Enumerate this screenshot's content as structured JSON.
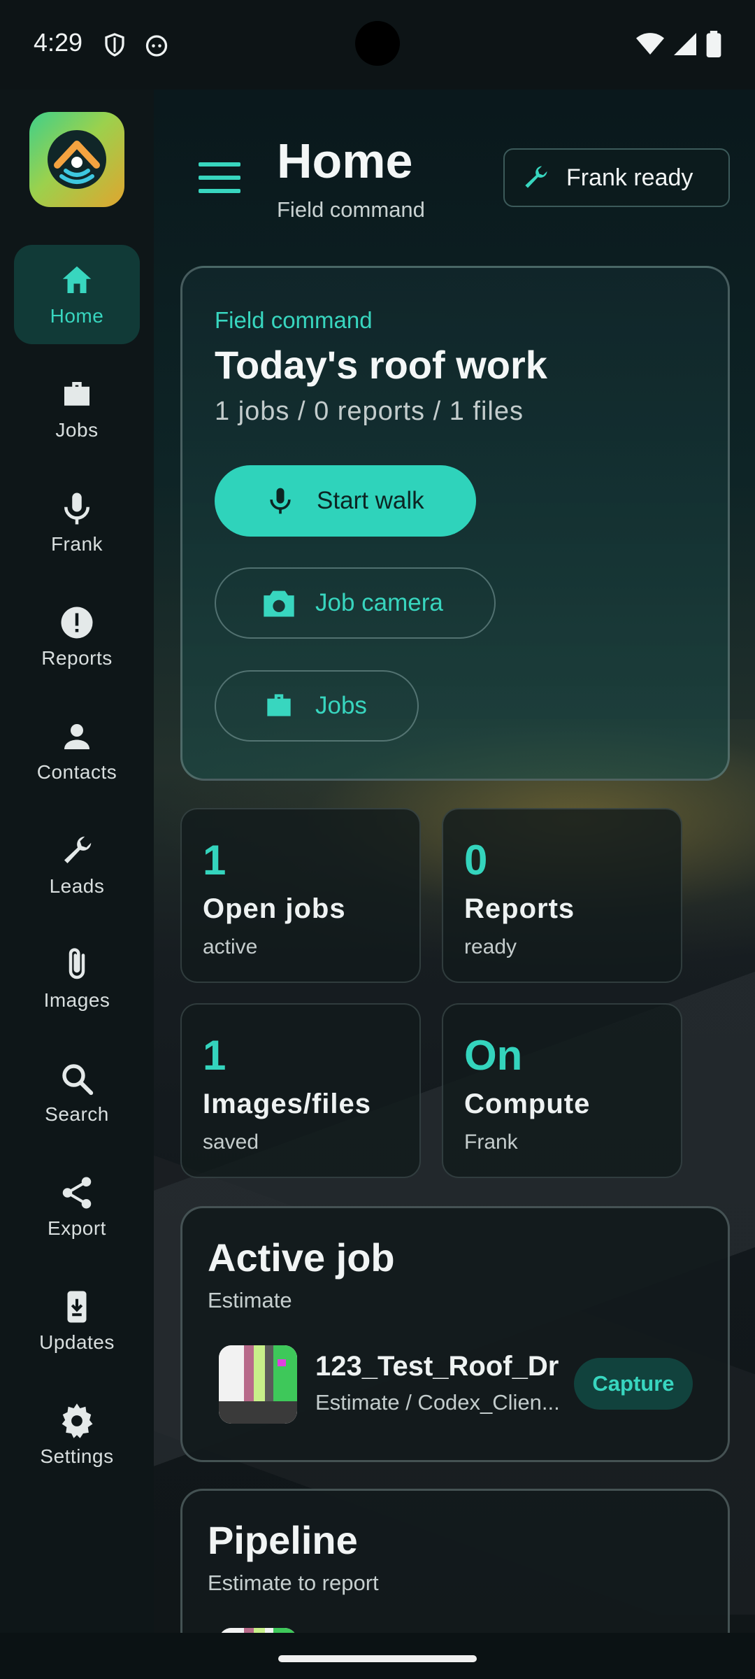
{
  "status_bar": {
    "time": "4:29",
    "icons": [
      "shield-icon",
      "android-face-icon",
      "wifi-icon",
      "signal-icon",
      "battery-icon"
    ]
  },
  "colors": {
    "accent": "#2fd3bb",
    "rail_bg": "#0e1618",
    "active_nav_bg": "#113a37"
  },
  "rail": {
    "items": [
      {
        "label": "Home",
        "icon": "home-icon",
        "active": true
      },
      {
        "label": "Jobs",
        "icon": "briefcase-icon"
      },
      {
        "label": "Frank",
        "icon": "microphone-icon"
      },
      {
        "label": "Reports",
        "icon": "alert-icon"
      },
      {
        "label": "Contacts",
        "icon": "person-icon"
      },
      {
        "label": "Leads",
        "icon": "wrench-icon"
      },
      {
        "label": "Images",
        "icon": "paperclip-icon"
      },
      {
        "label": "Search",
        "icon": "search-icon"
      },
      {
        "label": "Export",
        "icon": "share-icon"
      },
      {
        "label": "Updates",
        "icon": "download-icon"
      },
      {
        "label": "Settings",
        "icon": "gear-icon"
      }
    ]
  },
  "header": {
    "title": "Home",
    "subtitle": "Field command",
    "status_button": "Frank ready"
  },
  "hero": {
    "eyebrow": "Field command",
    "title": "Today's roof work",
    "summary": "1 jobs / 0 reports / 1 files",
    "primary_action": "Start walk",
    "secondary_actions": [
      "Job camera",
      "Jobs"
    ]
  },
  "stats": [
    {
      "value": "1",
      "title": "Open jobs",
      "sub": "active"
    },
    {
      "value": "0",
      "title": "Reports",
      "sub": "ready"
    },
    {
      "value": "1",
      "title": "Images/files",
      "sub": "saved"
    },
    {
      "value": "On",
      "title": "Compute",
      "sub": "Frank"
    }
  ],
  "active_job": {
    "title": "Active job",
    "subtitle": "Estimate",
    "job_name": "123_Test_Roof_Dr",
    "job_meta": "Estimate / Codex_Clien...",
    "action": "Capture"
  },
  "pipeline": {
    "title": "Pipeline",
    "subtitle": "Estimate to report"
  }
}
